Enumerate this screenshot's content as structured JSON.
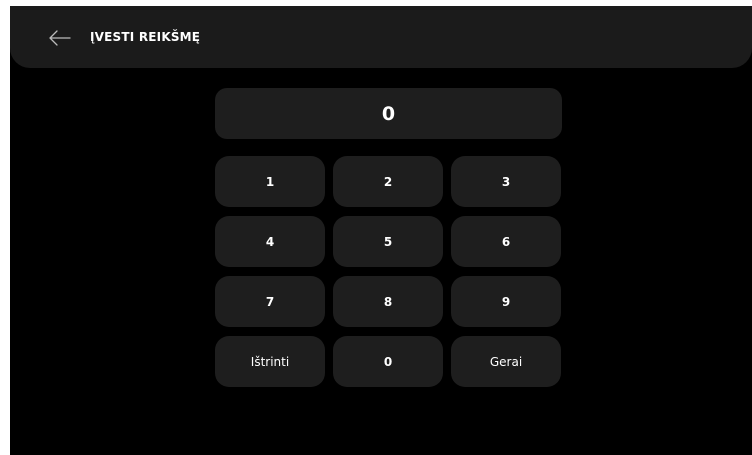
{
  "header": {
    "title": "ĮVESTI REIKŠMĘ",
    "back_icon": "arrow-left-icon"
  },
  "display": {
    "value": "0"
  },
  "keypad": {
    "keys": [
      "1",
      "2",
      "3",
      "4",
      "5",
      "6",
      "7",
      "8",
      "9",
      "Ištrinti",
      "0",
      "Gerai"
    ]
  },
  "colors": {
    "background": "#000000",
    "surface": "#1e1e1e",
    "header": "#1b1b1b",
    "text": "#ffffff"
  }
}
